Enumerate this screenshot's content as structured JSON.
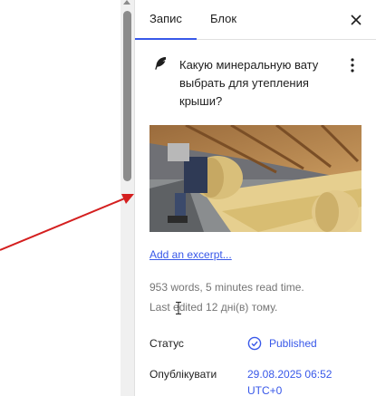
{
  "tabs": [
    {
      "label": "Запис",
      "active": true
    },
    {
      "label": "Блок",
      "active": false
    }
  ],
  "icons": {
    "close": "close-icon",
    "post_type": "feather-icon",
    "more": "more-vertical-icon",
    "status": "published-check-icon",
    "cursor": "text-cursor-icon",
    "annotation": "red-arrow"
  },
  "post": {
    "title": "Какую минеральную вату выбрать для утепления крыши?",
    "excerpt_link": "Add an excerpt...",
    "stats_words": "953 words, 5 minutes read time.",
    "stats_edited": "Last edited 12 дні(в) тому."
  },
  "summary": {
    "status_label": "Статус",
    "status_value": "Published",
    "publish_label": "Опублікувати",
    "publish_value": "29.08.2025 06:52 UTC+0"
  },
  "colors": {
    "accent": "#3858e9",
    "annotation": "#d41f1f",
    "muted_text": "#757575"
  }
}
